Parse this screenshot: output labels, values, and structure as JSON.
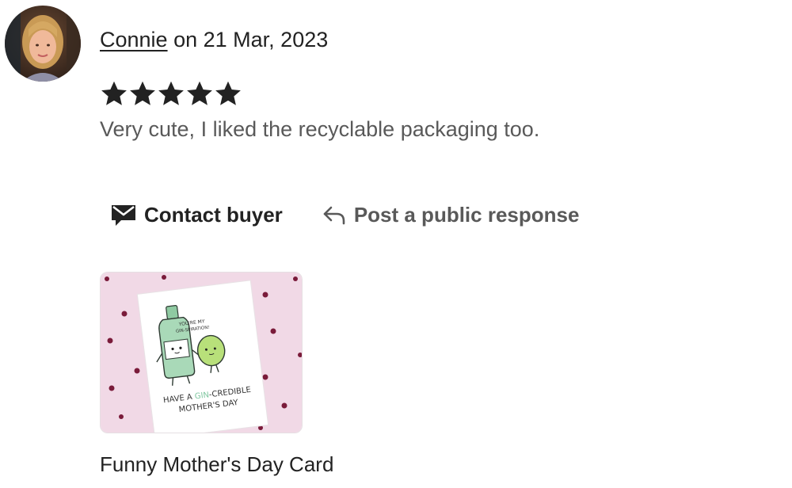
{
  "review": {
    "author": "Connie",
    "date_prefix": "on",
    "date": "21 Mar, 2023",
    "rating": 5,
    "rating_max": 5,
    "text": "Very cute, I liked the recyclable packaging too."
  },
  "actions": {
    "contact_label": "Contact buyer",
    "contact_icon": "envelope-icon",
    "respond_label": "Post a public response",
    "respond_icon": "reply-arrow-icon"
  },
  "product": {
    "title": "Funny Mother's Day Card",
    "card_text": {
      "bubble_line1": "YOU'RE MY",
      "bubble_line2": "GIN-SPIRATION!",
      "main_line1_a": "HAVE A ",
      "main_line1_b": "GIN",
      "main_line1_c": "-CREDIBLE",
      "main_line2": "MOTHER'S DAY"
    }
  },
  "colors": {
    "text_primary": "#222222",
    "text_secondary": "#595959",
    "card_background": "#f1d9e6",
    "heart_color": "#7a1b3a",
    "gin_bottle": "#a9d9b8",
    "lime": "#b8e07a"
  }
}
